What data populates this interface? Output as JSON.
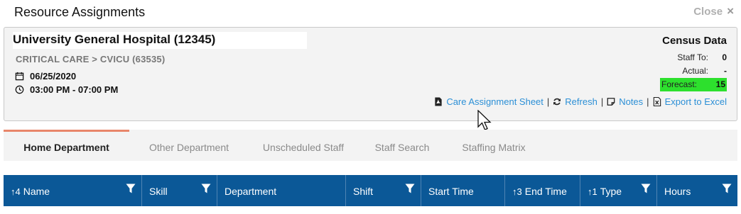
{
  "window": {
    "title": "Resource Assignments",
    "close_label": "Close",
    "close_icon": "×"
  },
  "header": {
    "hospital": "University General Hospital (12345)",
    "department_path": "CRITICAL CARE > CVICU (63535)",
    "date": "06/25/2020",
    "time_range": "03:00 PM - 07:00 PM"
  },
  "census": {
    "title": "Census Data",
    "rows": [
      {
        "label": "Staff To:",
        "value": "0"
      },
      {
        "label": "Actual:",
        "value": "-"
      },
      {
        "label": "Forecast:",
        "value": "15",
        "highlight": "#2de02d"
      }
    ]
  },
  "actions": [
    {
      "label": "Care Assignment Sheet",
      "icon": "pdf-icon"
    },
    {
      "label": "Refresh",
      "icon": "refresh-icon"
    },
    {
      "label": "Notes",
      "icon": "notes-icon"
    },
    {
      "label": "Export to Excel",
      "icon": "excel-icon"
    }
  ],
  "tabs": [
    {
      "label": "Home Department",
      "active": true
    },
    {
      "label": "Other Department",
      "active": false
    },
    {
      "label": "Unscheduled Staff",
      "active": false
    },
    {
      "label": "Staff Search",
      "active": false
    },
    {
      "label": "Staffing Matrix",
      "active": false
    }
  ],
  "grid": {
    "columns": [
      {
        "label": "Name",
        "sort": "↑4",
        "filter": true
      },
      {
        "label": "Skill",
        "sort": "",
        "filter": true
      },
      {
        "label": "Department",
        "sort": "",
        "filter": false
      },
      {
        "label": "Shift",
        "sort": "",
        "filter": true
      },
      {
        "label": "Start Time",
        "sort": "",
        "filter": false
      },
      {
        "label": "End Time",
        "sort": "↑3",
        "filter": false
      },
      {
        "label": "Type",
        "sort": "↑1",
        "filter": true
      },
      {
        "label": "Hours",
        "sort": "",
        "filter": true
      }
    ]
  },
  "colors": {
    "header_blue": "#0b5897",
    "link_blue": "#2b8fd6",
    "active_tab_accent": "#e8866a"
  }
}
